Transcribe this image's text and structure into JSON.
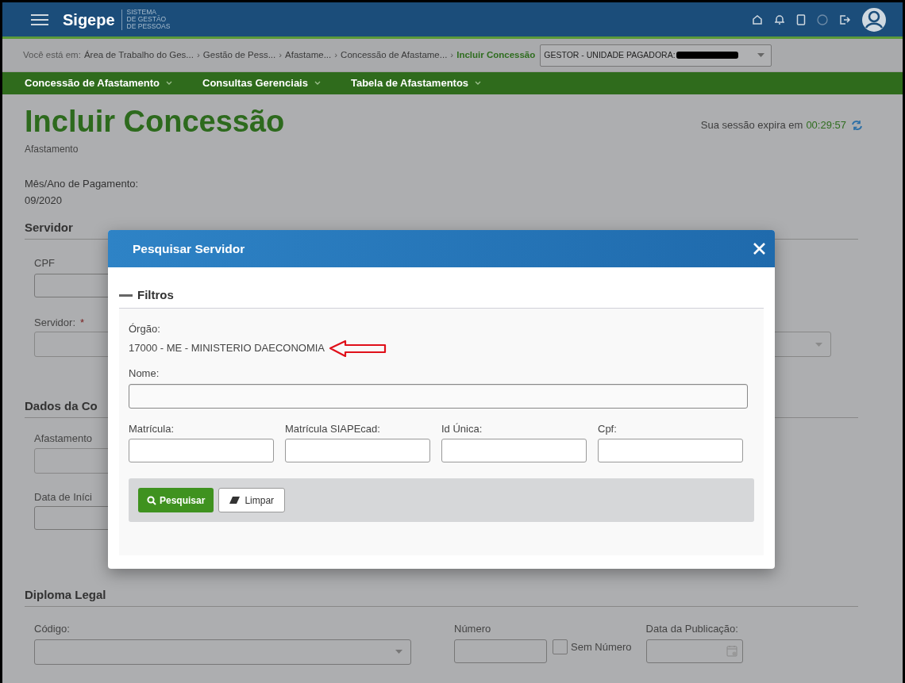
{
  "header": {
    "app_name": "Sigepe",
    "app_subtitle": [
      "SISTEMA",
      "DE GESTÃO",
      "DE PESSOAS"
    ]
  },
  "breadcrumb": {
    "label": "Você está em:",
    "separator": "›",
    "items": [
      {
        "text": "Área de Trabalho do Ges...",
        "selected": false
      },
      {
        "text": "Gestão de Pess...",
        "selected": false
      },
      {
        "text": "Afastame...",
        "selected": false
      },
      {
        "text": "Concessão de Afastame...",
        "selected": false
      },
      {
        "text": "Incluir Concessão",
        "selected": true
      }
    ],
    "profile_select": {
      "value": "GESTOR - UNIDADE PAGADORA:",
      "redacted": true
    }
  },
  "menu": [
    {
      "label": "Concessão de Afastamento"
    },
    {
      "label": "Consultas Gerenciais"
    },
    {
      "label": "Tabela de Afastamentos"
    }
  ],
  "page": {
    "title": "Incluir Concessão",
    "subtitle": "Afastamento",
    "session_text": "Sua sessão expira em",
    "session_time": "00:29:57",
    "payment_label": "Mês/Ano de Pagamento:",
    "payment_value": "09/2020",
    "servidor_section": "Servidor",
    "cpf_label": "CPF",
    "servidor_label": "Servidor:",
    "required_mark": "*",
    "dados_section": "Dados da Co",
    "afastamento_label": "Afastamento",
    "data_inicio_label": "Data de Iníci",
    "diploma_section": "Diploma Legal",
    "codigo_label": "Código:",
    "numero_label": "Número",
    "sem_numero": {
      "label": "Sem Número",
      "checked": false
    },
    "data_publicacao_label": "Data da Publicação:"
  },
  "modal": {
    "title": "Pesquisar Servidor",
    "filters_legend": "Filtros",
    "orgao_label": "Órgão:",
    "orgao_value": "17000 - ME - MINISTERIO DAECONOMIA",
    "nome_label": "Nome:",
    "fields": [
      {
        "label": "Matrícula:"
      },
      {
        "label": "Matrícula SIAPEcad:"
      },
      {
        "label": "Id Única:"
      },
      {
        "label": "Cpf:"
      }
    ],
    "buttons": [
      {
        "kind": "primary",
        "label": "Pesquisar"
      },
      {
        "kind": "secondary",
        "label": "Limpar"
      }
    ]
  }
}
